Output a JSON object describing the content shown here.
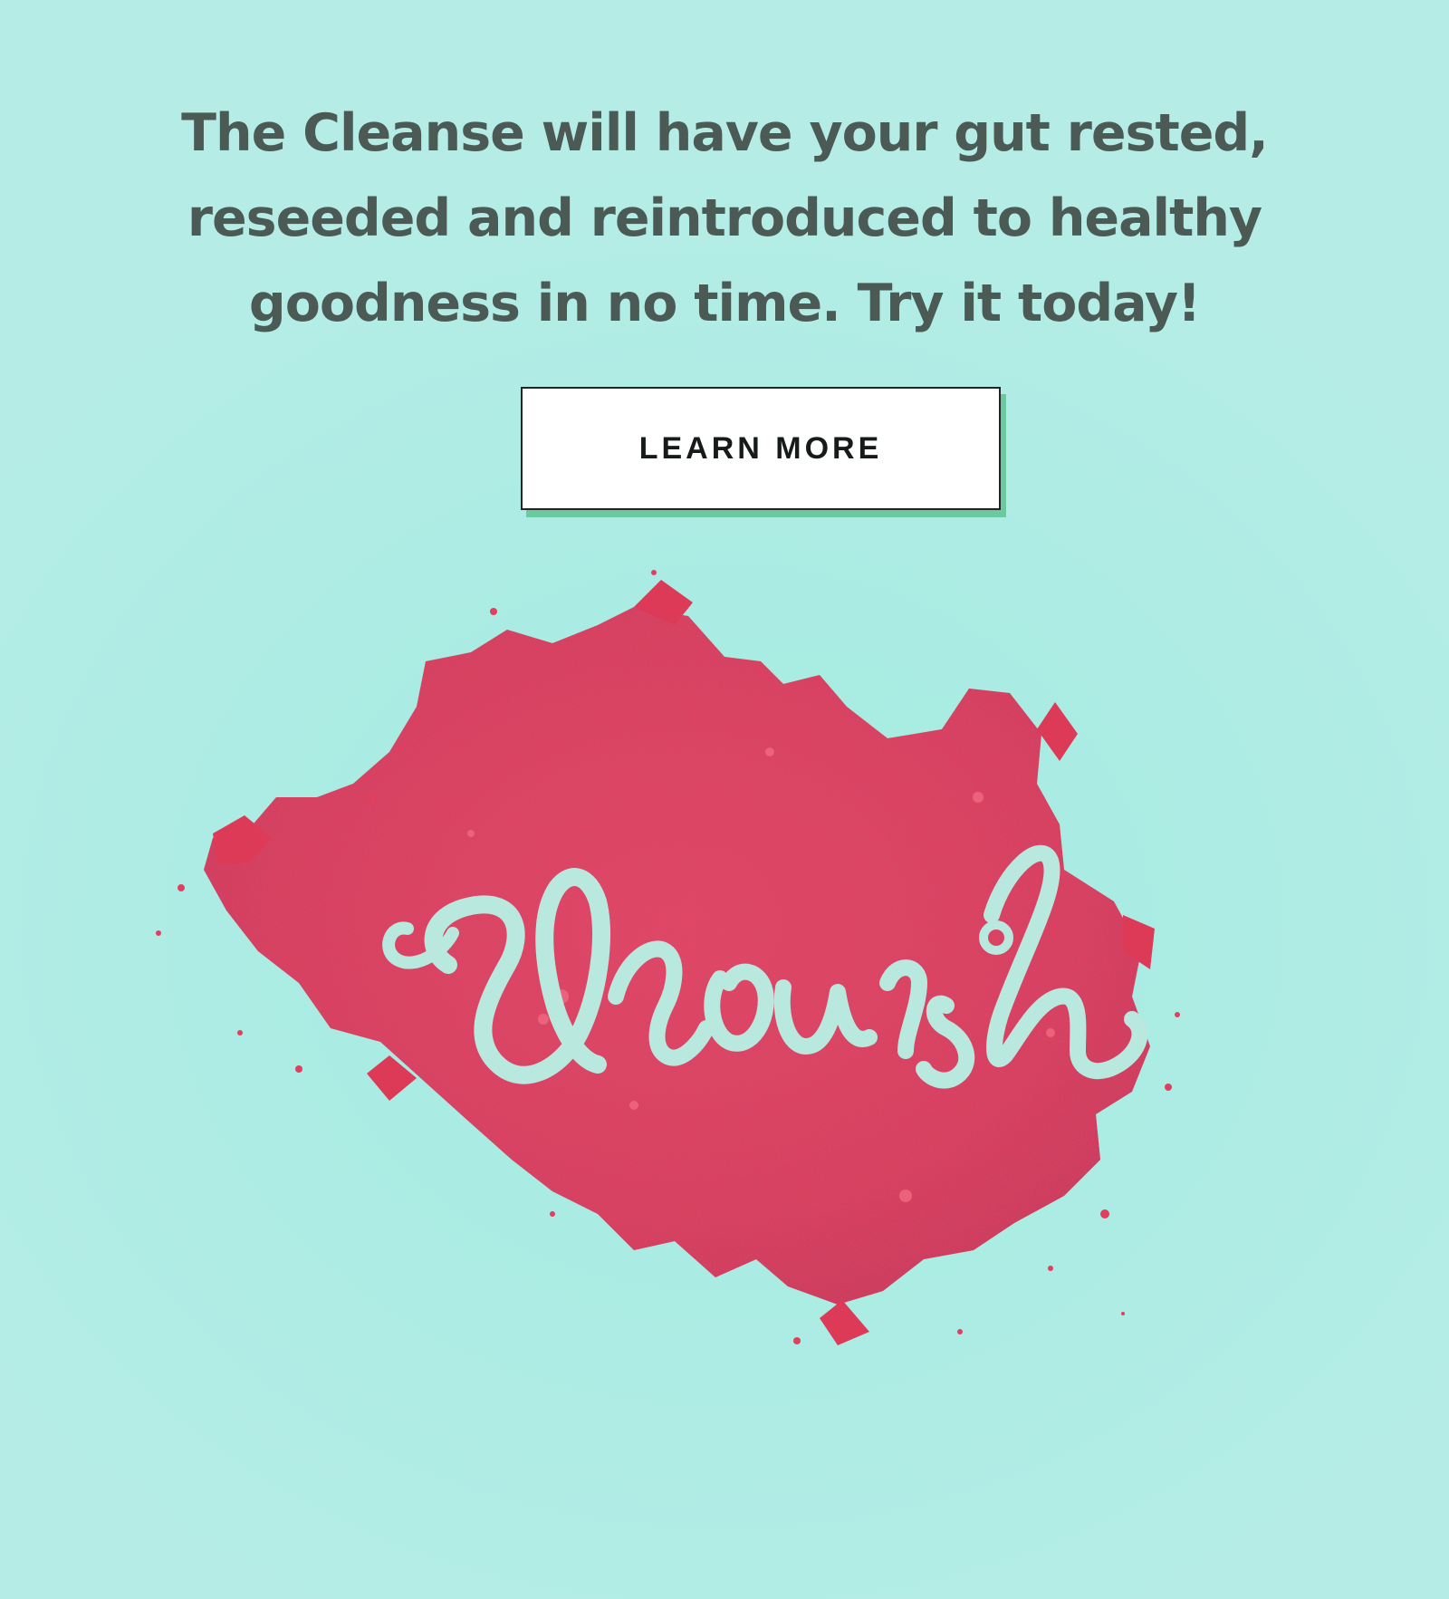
{
  "promo": {
    "lines": [
      "The Cleanse will have your gut rested,",
      "reseeded and reintroduced to healthy",
      "goodness in no time. Try it today!"
    ],
    "cta_label": "LEARN MORE"
  },
  "image": {
    "lettering": "flourish",
    "powder_color": "#e23c5a",
    "background_color": "#aaece3"
  }
}
